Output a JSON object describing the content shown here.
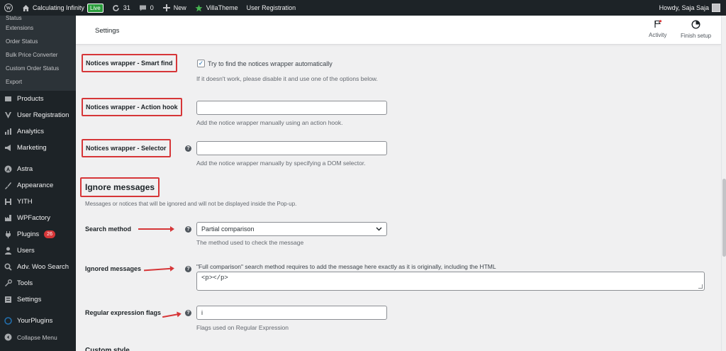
{
  "adminbar": {
    "site_name": "Calculating Infinity",
    "live_badge": "Live",
    "updates_count": "31",
    "comments_count": "0",
    "new_label": "New",
    "villatheme_label": "VillaTheme",
    "user_registration_label": "User Registration",
    "howdy_text": "Howdy, Saja Saja"
  },
  "sidebar": {
    "submenu": [
      {
        "label": "Status"
      },
      {
        "label": "Extensions"
      },
      {
        "label": "Order Status"
      },
      {
        "label": "Bulk Price Converter"
      },
      {
        "label": "Custom Order Status"
      },
      {
        "label": "Export"
      }
    ],
    "menu": [
      {
        "label": "Products",
        "icon": "products-icon"
      },
      {
        "label": "User Registration",
        "icon": "user-registration-icon"
      },
      {
        "label": "Analytics",
        "icon": "analytics-icon"
      },
      {
        "label": "Marketing",
        "icon": "marketing-icon"
      },
      {
        "label": "Astra",
        "icon": "astra-icon"
      },
      {
        "label": "Appearance",
        "icon": "appearance-icon"
      },
      {
        "label": "YITH",
        "icon": "yith-icon"
      },
      {
        "label": "WPFactory",
        "icon": "wpfactory-icon"
      },
      {
        "label": "Plugins",
        "icon": "plugins-icon",
        "badge": "26"
      },
      {
        "label": "Users",
        "icon": "users-icon"
      },
      {
        "label": "Adv. Woo Search",
        "icon": "search-icon"
      },
      {
        "label": "Tools",
        "icon": "tools-icon"
      },
      {
        "label": "Settings",
        "icon": "settings-icon"
      },
      {
        "label": "YourPlugins",
        "icon": "yourplugins-icon"
      },
      {
        "label": "Collapse Menu",
        "icon": "collapse-icon"
      }
    ]
  },
  "header": {
    "title": "Settings",
    "activity_label": "Activity",
    "finish_setup_label": "Finish setup"
  },
  "form": {
    "smart_find": {
      "label": "Notices wrapper - Smart find",
      "checkbox_label": "Try to find the notices wrapper automatically",
      "checked": true,
      "description": "If it doesn't work, please disable it and use one of the options below."
    },
    "action_hook": {
      "label": "Notices wrapper - Action hook",
      "value": "",
      "description": "Add the notice wrapper manually using an action hook."
    },
    "selector": {
      "label": "Notices wrapper - Selector",
      "value": "",
      "description": "Add the notice wrapper manually by specifying a DOM selector."
    },
    "ignore_section": {
      "title": "Ignore messages",
      "description": "Messages or notices that will be ignored and will not be displayed inside the Pop-up."
    },
    "search_method": {
      "label": "Search method",
      "value": "Partial comparison",
      "description": "The method used to check the message"
    },
    "ignored_messages": {
      "label": "Ignored messages",
      "note": "\"Full comparison\" search method requires to add the message here exactly as it is originally, including the HTML",
      "value": "<p></p>"
    },
    "regex_flags": {
      "label": "Regular expression flags",
      "value": "i",
      "description": "Flags used on Regular Expression"
    },
    "next_section_partial": "Custom style"
  },
  "colors": {
    "annotation_red": "#d63638",
    "wp_dark": "#1d2327",
    "checkbox_blue": "#2271b1"
  }
}
